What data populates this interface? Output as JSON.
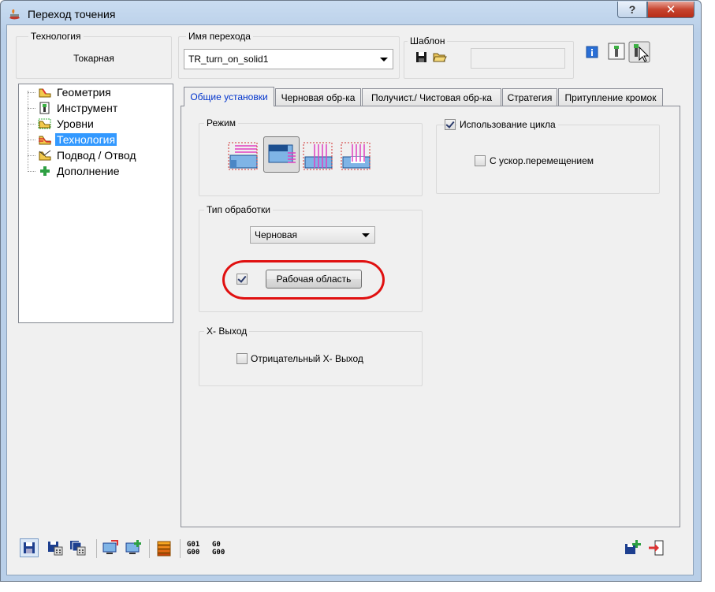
{
  "window": {
    "title": "Переход точения",
    "help_symbol": "?",
    "close_symbol": "✕"
  },
  "header": {
    "technology_label": "Технология",
    "technology_value": "Токарная",
    "step_name_label": "Имя перехода",
    "step_name_value": "TR_turn_on_solid1",
    "template_label": "Шаблон",
    "template_field_value": ""
  },
  "tree": {
    "items": [
      {
        "label": "Геометрия",
        "icon": "geometry-icon"
      },
      {
        "label": "Инструмент",
        "icon": "tool-icon"
      },
      {
        "label": "Уровни",
        "icon": "levels-icon"
      },
      {
        "label": "Технология",
        "icon": "technology-icon",
        "selected": true
      },
      {
        "label": "Подвод / Отвод",
        "icon": "approach-retract-icon"
      },
      {
        "label": "Дополнение",
        "icon": "plus-icon"
      }
    ]
  },
  "tabs": [
    {
      "label": "Общие установки",
      "active": true
    },
    {
      "label": "Черновая обр-ка"
    },
    {
      "label": "Получист./ Чистовая обр-ка"
    },
    {
      "label": "Стратегия"
    },
    {
      "label": "Притупление кромок"
    }
  ],
  "general": {
    "mode_label": "Режим",
    "modes": [
      "face-turning-icon",
      "profile-corner-icon",
      "longitudinal-turning-icon",
      "groove-turning-icon"
    ],
    "use_cycle_label": "Использование цикла",
    "use_cycle_checked": true,
    "rapid_move_label": "С ускор.перемещением",
    "rapid_move_checked": false,
    "processing_type_label": "Тип обработки",
    "processing_type_value": "Черновая",
    "work_area_checked": true,
    "work_area_button": "Рабочая область",
    "x_exit_label": "X- Выход",
    "negative_x_exit_label": "Отрицательный X- Выход",
    "negative_x_exit_checked": false
  },
  "bottom_toolbar": {
    "gcode_1": "G01\nG00",
    "gcode_2": "G0\nG00"
  },
  "colors": {
    "accent": "#3399ff",
    "highlight": "#e01010",
    "tab_active_text": "#0033cc"
  }
}
